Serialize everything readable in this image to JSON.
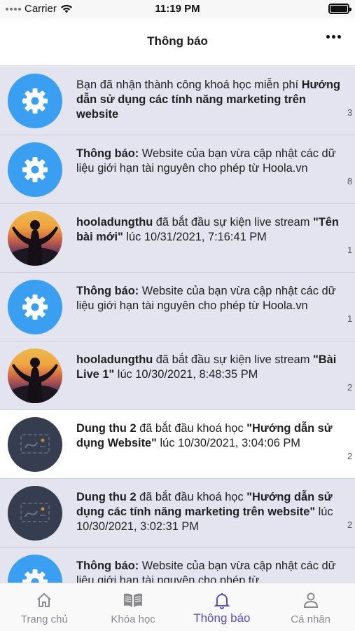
{
  "status_bar": {
    "carrier": "Carrier",
    "time": "11:19 PM"
  },
  "header": {
    "title": "Thông báo",
    "more_icon": "more-horizontal-icon"
  },
  "notifications": [
    {
      "kind": "gear",
      "state": "unread",
      "parts": [
        {
          "text": "Bạn đã nhận thành công khoá học miễn phí ",
          "bold": false
        },
        {
          "text": "Hướng dẫn sử dụng các tính năng marketing trên website",
          "bold": true
        }
      ],
      "time": "3"
    },
    {
      "kind": "gear",
      "state": "unread",
      "parts": [
        {
          "text": "Thông báo:",
          "bold": true
        },
        {
          "text": " Website của bạn vừa cập nhật các dữ liệu giới hạn tài nguyên cho phép từ Hoola.vn",
          "bold": false
        }
      ],
      "time": "8"
    },
    {
      "kind": "photo",
      "state": "unread",
      "parts": [
        {
          "text": "hooladungthu",
          "bold": true
        },
        {
          "text": " đã bắt đầu sự kiện live stream ",
          "bold": false
        },
        {
          "text": "\"Tên bài mới\"",
          "bold": true
        },
        {
          "text": " lúc 10/31/2021, 7:16:41 PM",
          "bold": false
        }
      ],
      "time": "1"
    },
    {
      "kind": "gear",
      "state": "unread",
      "parts": [
        {
          "text": "Thông báo:",
          "bold": true
        },
        {
          "text": " Website của bạn vừa cập nhật các dữ liệu giới hạn tài nguyên cho phép từ Hoola.vn",
          "bold": false
        }
      ],
      "time": "1"
    },
    {
      "kind": "photo",
      "state": "unread",
      "parts": [
        {
          "text": "hooladungthu",
          "bold": true
        },
        {
          "text": " đã bắt đầu sự kiện live stream ",
          "bold": false
        },
        {
          "text": "\"Bài Live 1\"",
          "bold": true
        },
        {
          "text": " lúc 10/30/2021, 8:48:35 PM",
          "bold": false
        }
      ],
      "time": "2"
    },
    {
      "kind": "course",
      "state": "read",
      "parts": [
        {
          "text": "Dung thu 2",
          "bold": true
        },
        {
          "text": " đã bắt đầu khoá học ",
          "bold": false
        },
        {
          "text": "\"Hướng dẫn sử dụng Website\"",
          "bold": true
        },
        {
          "text": " lúc 10/30/2021, 3:04:06 PM",
          "bold": false
        }
      ],
      "time": "2"
    },
    {
      "kind": "course",
      "state": "unread",
      "parts": [
        {
          "text": "Dung thu 2",
          "bold": true
        },
        {
          "text": " đã bắt đầu khoá học ",
          "bold": false
        },
        {
          "text": "\"Hướng dẫn sử dụng các tính năng marketing trên website\"",
          "bold": true
        },
        {
          "text": " lúc 10/30/2021, 3:02:31 PM",
          "bold": false
        }
      ],
      "time": "2"
    },
    {
      "kind": "gear",
      "state": "unread",
      "parts": [
        {
          "text": "Thông báo:",
          "bold": true
        },
        {
          "text": " Website của bạn vừa cập nhật các dữ liệu giới hạn tài nguyên cho phép từ",
          "bold": false
        }
      ],
      "time": ""
    }
  ],
  "tabs": [
    {
      "id": "home",
      "label": "Trang chủ",
      "icon": "home-icon",
      "active": false
    },
    {
      "id": "courses",
      "label": "Khóa học",
      "icon": "book-icon",
      "active": false
    },
    {
      "id": "notifications",
      "label": "Thông báo",
      "icon": "bell-icon",
      "active": true
    },
    {
      "id": "profile",
      "label": "Cá nhân",
      "icon": "user-icon",
      "active": false
    }
  ],
  "colors": {
    "accent": "#5b4cc4",
    "unread_bg": "#e4e3f0",
    "gear_avatar": "#3a9ef1",
    "course_avatar": "#353d4e"
  }
}
